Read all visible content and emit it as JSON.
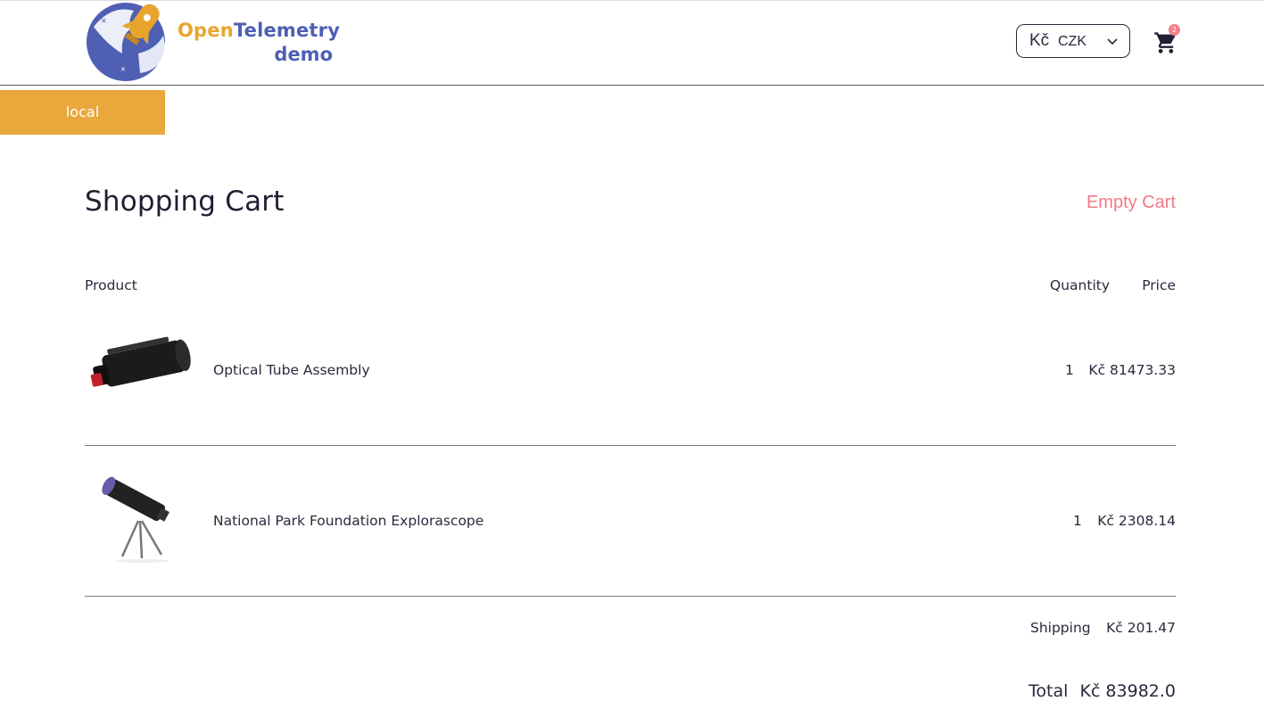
{
  "header": {
    "brand_open": "Open",
    "brand_telemetry": "Telemetry",
    "brand_demo": "demo",
    "currency_symbol": "Kč",
    "currency_code": "CZK",
    "cart_count": "2",
    "icons": [
      "rocket-logo-icon",
      "chevron-down-icon",
      "cart-icon"
    ]
  },
  "environment_badge": "local",
  "cart": {
    "title": "Shopping Cart",
    "empty_label": "Empty Cart",
    "columns": {
      "product": "Product",
      "quantity": "Quantity",
      "price": "Price"
    },
    "items": [
      {
        "name": "Optical Tube Assembly",
        "quantity": "1",
        "price": "Kč 81473.33"
      },
      {
        "name": "National Park Foundation Explorascope",
        "quantity": "1",
        "price": "Kč 2308.14"
      }
    ],
    "shipping_label": "Shipping",
    "shipping_value": "Kč 201.47",
    "total_label": "Total",
    "total_value": "Kč 83982.0"
  },
  "colors": {
    "accent_orange": "#eaa73b",
    "brand_blue": "#4e5fb4",
    "empty_cart_pink": "#f07b85",
    "text_dark": "#29293e"
  }
}
